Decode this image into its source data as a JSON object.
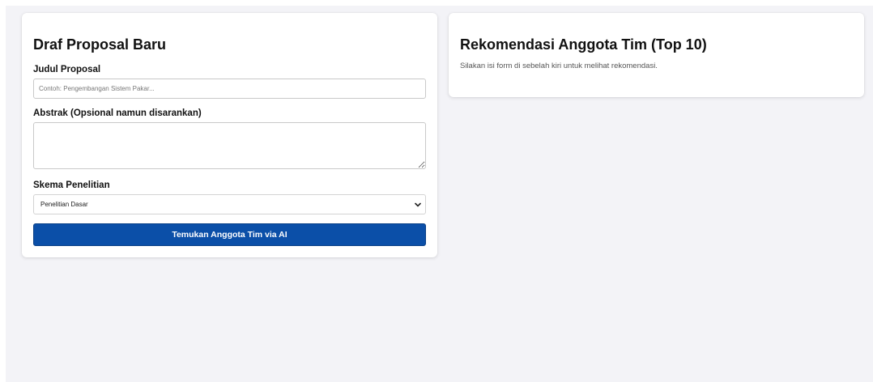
{
  "left_panel": {
    "title": "Draf Proposal Baru",
    "judul_label": "Judul Proposal",
    "judul_placeholder": "Contoh: Pengembangan Sistem Pakar...",
    "judul_value": "",
    "abstrak_label": "Abstrak (Opsional namun disarankan)",
    "abstrak_value": "",
    "skema_label": "Skema Penelitian",
    "skema_selected": "Penelitian Dasar",
    "submit_label": "Temukan Anggota Tim via AI",
    "icons": [
      "chevron-down-icon",
      "resize-handle-icon"
    ]
  },
  "right_panel": {
    "title": "Rekomendasi Anggota Tim (Top 10)",
    "hint": "Silakan isi form di sebelah kiri untuk melihat rekomendasi."
  },
  "colors": {
    "page_background": "#f3f3f7",
    "card_background": "#ffffff",
    "primary_button": "#0b4fa8",
    "button_text": "#ffffff"
  }
}
